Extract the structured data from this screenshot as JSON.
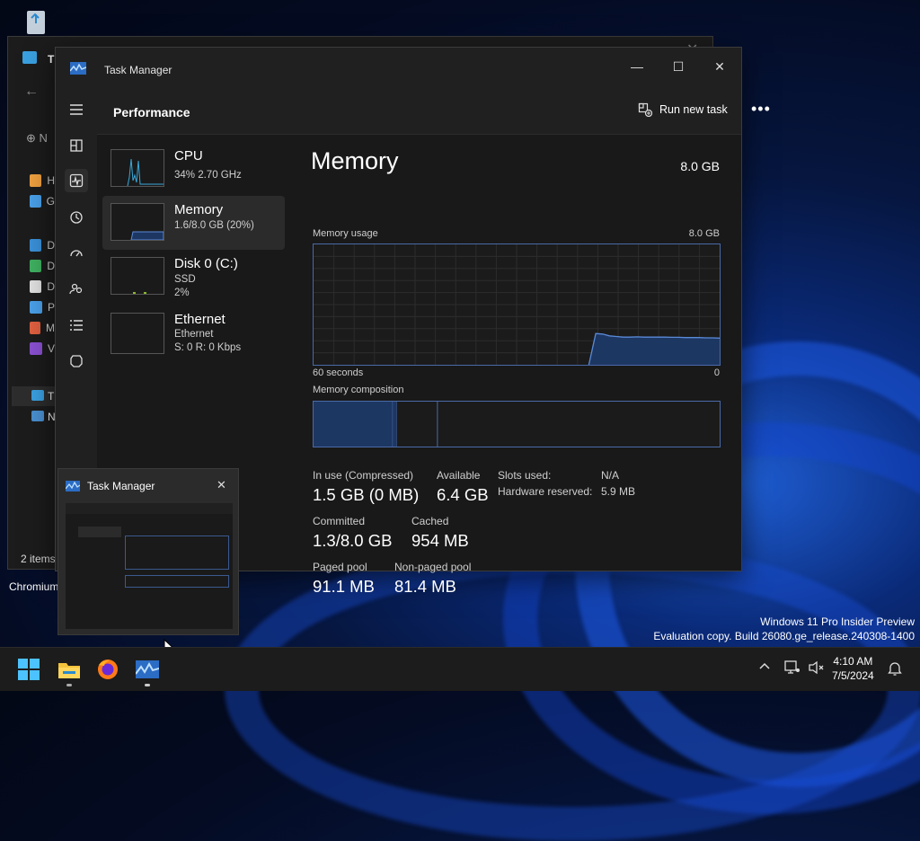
{
  "desktop": {
    "recycle_bin_label": "",
    "chromium_label": "Chromium"
  },
  "explorer": {
    "title": "Th",
    "nav_new": "N",
    "sidebar": [
      {
        "label": "H",
        "color": "#f0a040"
      },
      {
        "label": "G",
        "color": "#4aa0e8"
      },
      {
        "label": "D",
        "color": "#3a90d8"
      },
      {
        "label": "D",
        "color": "#3fb060"
      },
      {
        "label": "D",
        "color": "#e0e0e0"
      },
      {
        "label": "P",
        "color": "#4aa0e8"
      },
      {
        "label": "M",
        "color": "#e06040"
      },
      {
        "label": "V",
        "color": "#8a50d0"
      }
    ],
    "this_pc": "T",
    "network": "N",
    "status": "2 items"
  },
  "task_manager": {
    "title": "Task Manager",
    "page_title": "Performance",
    "run_new_task": "Run new task",
    "more": "•••",
    "resources": [
      {
        "name": "CPU",
        "sub1": "34% 2.70 GHz",
        "sub2": ""
      },
      {
        "name": "Memory",
        "sub1": "1.6/8.0 GB (20%)",
        "sub2": ""
      },
      {
        "name": "Disk 0 (C:)",
        "sub1": "SSD",
        "sub2": "2%"
      },
      {
        "name": "Ethernet",
        "sub1": "Ethernet",
        "sub2": "S: 0 R: 0 Kbps"
      }
    ],
    "memory": {
      "title": "Memory",
      "total": "8.0 GB",
      "usage_label": "Memory usage",
      "usage_max": "8.0 GB",
      "time_left": "60 seconds",
      "time_right": "0",
      "composition_label": "Memory composition",
      "usage_series_fraction": [
        0,
        0,
        0,
        0,
        0,
        0,
        0,
        0,
        0,
        0,
        0,
        0,
        0,
        0,
        0,
        0,
        0,
        0,
        0,
        0,
        0,
        0,
        0,
        0,
        0,
        0,
        0,
        0,
        0,
        0,
        0,
        0,
        0,
        0,
        0,
        0,
        0,
        0,
        0,
        0,
        0.0,
        0.26,
        0.255,
        0.24,
        0.235,
        0.23,
        0.23,
        0.232,
        0.23,
        0.23,
        0.23,
        0.23,
        0.228,
        0.228,
        0.226,
        0.226,
        0.226,
        0.224,
        0.224,
        0.222
      ],
      "composition": {
        "in_use": 0.195,
        "modified": 0.01,
        "standby": 0.1
      },
      "stats": {
        "in_use_label": "In use (Compressed)",
        "in_use_value": "1.5 GB (0 MB)",
        "available_label": "Available",
        "available_value": "6.4 GB",
        "committed_label": "Committed",
        "committed_value": "1.3/8.0 GB",
        "cached_label": "Cached",
        "cached_value": "954 MB",
        "paged_label": "Paged pool",
        "paged_value": "91.1 MB",
        "nonpaged_label": "Non-paged pool",
        "nonpaged_value": "81.4 MB",
        "slots_label": "Slots used:",
        "slots_value": "N/A",
        "hw_label": "Hardware reserved:",
        "hw_value": "5.9 MB"
      }
    }
  },
  "preview": {
    "title": "Task Manager"
  },
  "watermark": {
    "line1": "Windows 11 Pro Insider Preview",
    "line2": "Evaluation copy. Build 26080.ge_release.240308-1400"
  },
  "taskbar": {
    "time": "4:10 AM",
    "date": "7/5/2024"
  },
  "colors": {
    "accent": "#2a6ce0",
    "graph_line": "#5a8ad8",
    "graph_fill": "#1d3763"
  }
}
